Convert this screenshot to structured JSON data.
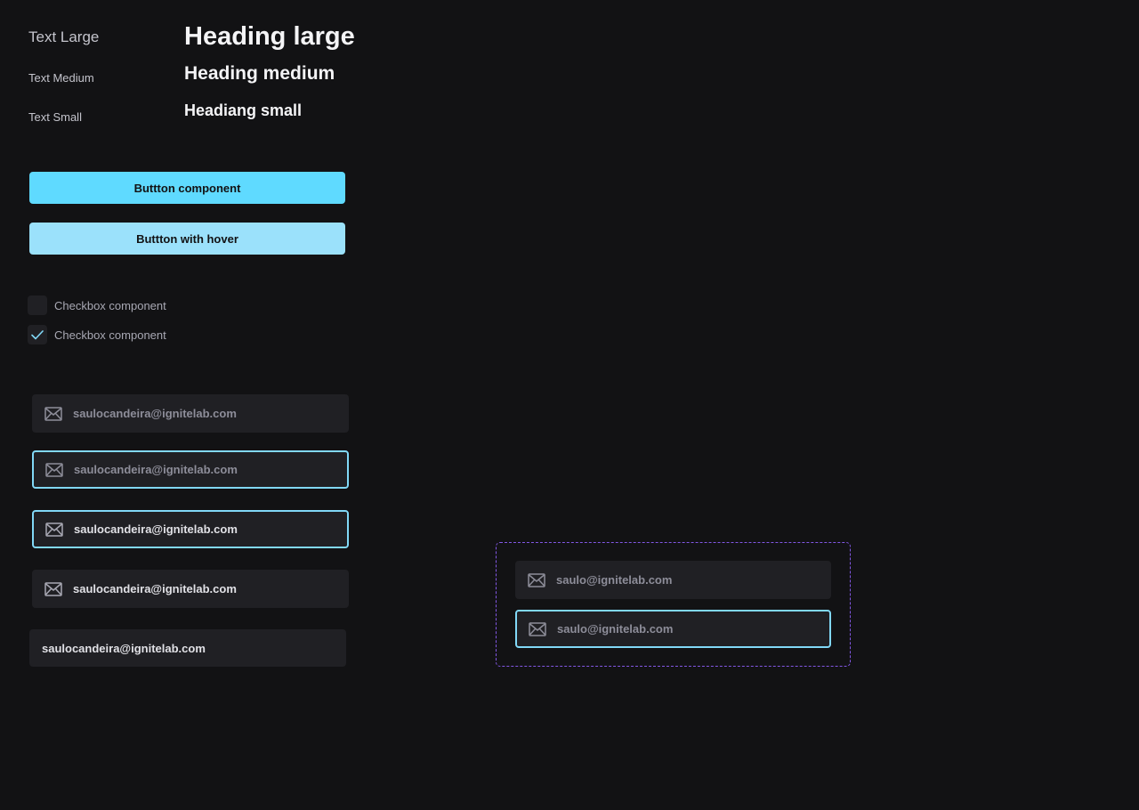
{
  "typography": {
    "text_large": "Text Large",
    "text_medium": "Text Medium",
    "text_small": "Text Small",
    "heading_large": "Heading large",
    "heading_medium": "Heading medium",
    "heading_small": "Headiang small"
  },
  "buttons": {
    "primary_label": "Buttton component",
    "hover_label": "Buttton with hover"
  },
  "checkboxes": [
    {
      "label": "Checkbox component",
      "checked": false
    },
    {
      "label": "Checkbox component",
      "checked": true
    }
  ],
  "inputs": [
    {
      "value": "saulocandeira@ignitelab.com",
      "state": "default",
      "icon": "mail-icon"
    },
    {
      "value": "saulocandeira@ignitelab.com",
      "state": "focus",
      "icon": "mail-icon"
    },
    {
      "value": "saulocandeira@ignitelab.com",
      "state": "focus-filled",
      "icon": "mail-icon"
    },
    {
      "value": "saulocandeira@ignitelab.com",
      "state": "filled",
      "icon": "mail-icon"
    },
    {
      "value": "saulocandeira@ignitelab.com",
      "state": "no-icon"
    }
  ],
  "variant_group": [
    {
      "value": "saulo@ignitelab.com",
      "state": "default",
      "icon": "mail-icon"
    },
    {
      "value": "saulo@ignitelab.com",
      "state": "focus",
      "icon": "mail-icon"
    }
  ],
  "colors": {
    "background": "#121214",
    "surface": "#202024",
    "primary": "#5fdaff",
    "primary_hover": "#9be1fb",
    "focus_border": "#81D8F7",
    "check": "#81D8F7",
    "variant_frame": "#8257E5"
  }
}
